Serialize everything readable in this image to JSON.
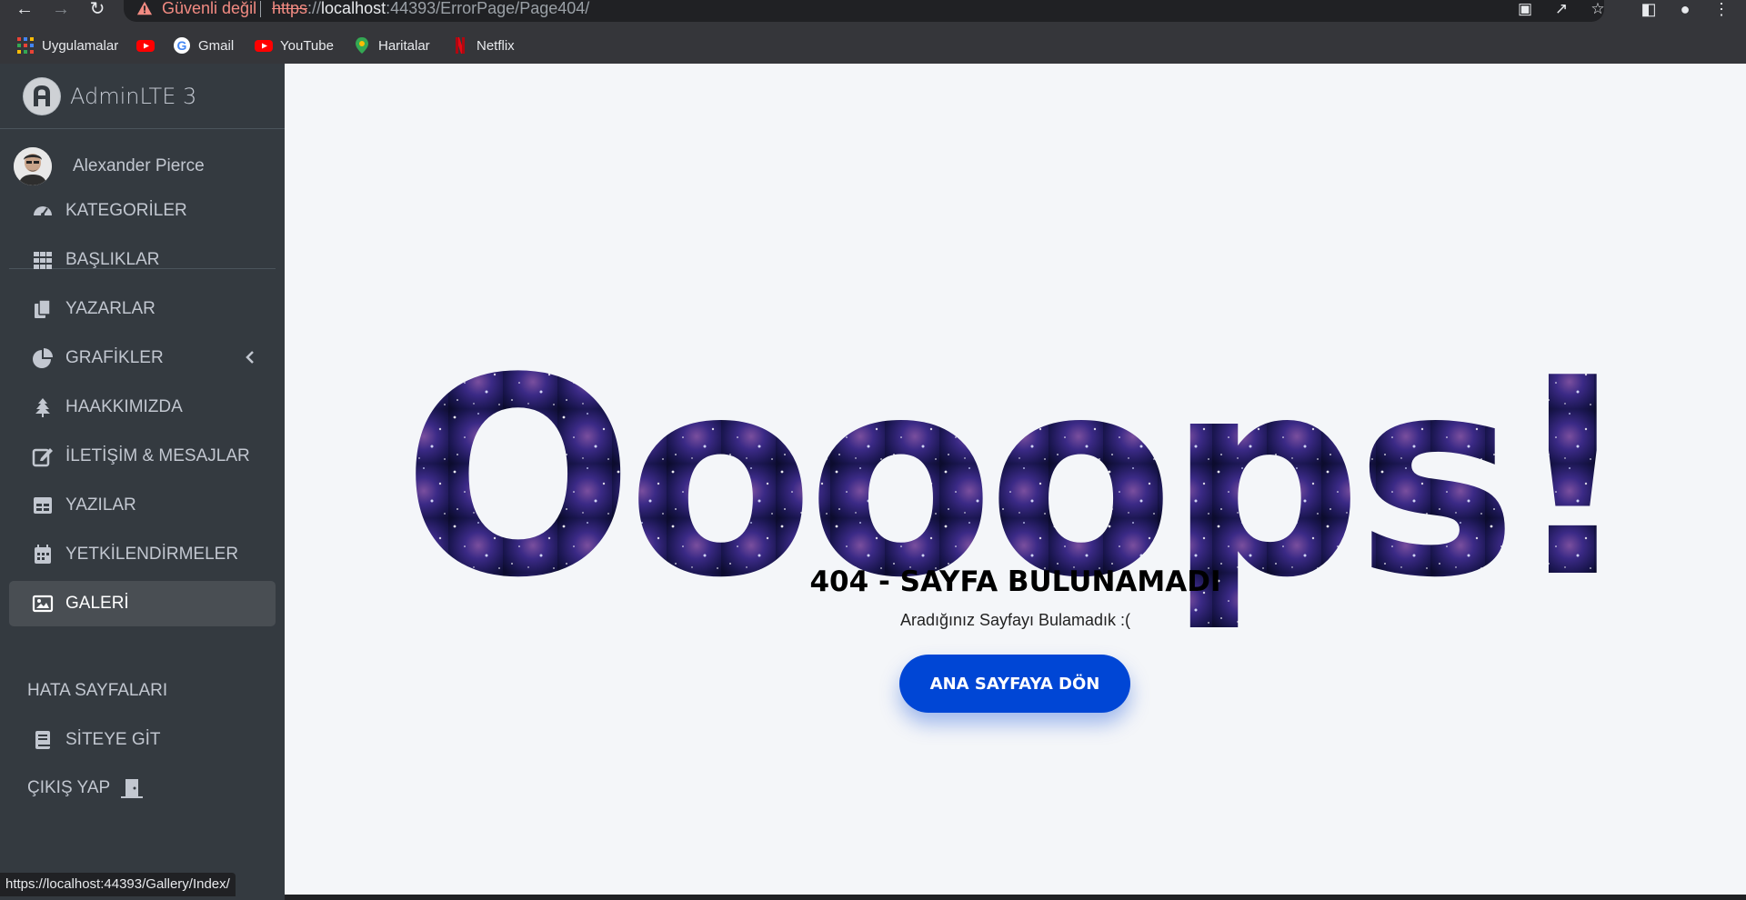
{
  "browser": {
    "not_secure": "Güvenli değil",
    "url_scheme": "https",
    "url_sep": "://",
    "url_host": "localhost",
    "url_rest": ":44393/ErrorPage/Page404/",
    "bookmarks": [
      "Uygulamalar",
      "Gmail",
      "YouTube",
      "Haritalar",
      "Netflix"
    ],
    "status_url": "https://localhost:44393/Gallery/Index/"
  },
  "sidebar": {
    "brand": "AdminLTE 3",
    "user_name": "Alexander Pierce",
    "items": [
      {
        "label": "KATEGORİLER",
        "icon": "tachometer-icon"
      },
      {
        "label": "BAŞLIKLAR",
        "icon": "grid-icon"
      },
      {
        "label": "YAZARLAR",
        "icon": "copy-icon"
      },
      {
        "label": "GRAFİKLER",
        "icon": "pie-chart-icon"
      },
      {
        "label": "HAAKKIMIZDA",
        "icon": "tree-icon"
      },
      {
        "label": "İLETİŞİM & MESAJLAR",
        "icon": "edit-icon"
      },
      {
        "label": "YAZILAR",
        "icon": "table-icon"
      },
      {
        "label": "YETKİLENDİRMELER",
        "icon": "calendar-icon"
      },
      {
        "label": "GALERİ",
        "icon": "image-icon",
        "active": true
      }
    ],
    "error_pages": "HATA SAYFALARI",
    "site_link": "SİTEYE GİT",
    "logout": "ÇIKIŞ YAP"
  },
  "error": {
    "headline": "Oooops!",
    "title": "404 - SAYFA BULUNAMADI",
    "subtitle": "Aradığınız Sayfayı Bulamadık :(",
    "button": "ANA SAYFAYA DÖN"
  },
  "colors": {
    "sidebar_bg": "#343a40",
    "active_item": "#494e53",
    "button": "#0046d5",
    "warning": "#f28b82"
  }
}
